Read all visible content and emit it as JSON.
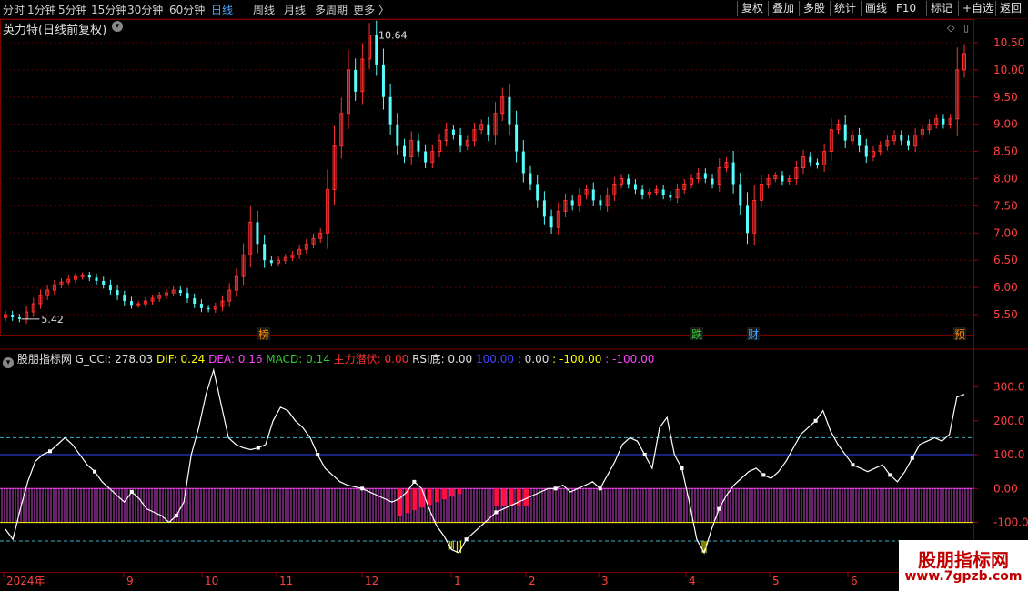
{
  "toolbar": {
    "periods": [
      "分时",
      "1分钟",
      "5分钟",
      "15分钟",
      "30分钟",
      "60分钟",
      "日线",
      "周线",
      "月线",
      "多周期",
      "更多"
    ],
    "active_period": "日线",
    "buttons": [
      "复权",
      "叠加",
      "多股",
      "统计",
      "画线",
      "F10",
      "标记",
      "+自选",
      "返回"
    ]
  },
  "main_chart": {
    "title": "英力特(日线前复权)",
    "price_axis": [
      "10.50",
      "10.00",
      "9.50",
      "9.00",
      "8.50",
      "8.00",
      "7.50",
      "7.00",
      "6.50",
      "6.00",
      "5.50"
    ],
    "high_label": "10.64",
    "low_label": "5.42",
    "markers": [
      {
        "text": "榜",
        "color": "#ff8c00"
      },
      {
        "text": "跌",
        "color": "#33cc33"
      },
      {
        "text": "财",
        "color": "#4da6ff"
      },
      {
        "text": "预",
        "color": "#ff8c00"
      }
    ]
  },
  "indicator": {
    "name": "股朋指标网",
    "items": [
      {
        "label": "G_CCI: 278.03",
        "color": "#e0e0e0"
      },
      {
        "label": "DIF: 0.24",
        "color": "#ffff00"
      },
      {
        "label": "DEA: 0.16",
        "color": "#ff44ff"
      },
      {
        "label": "MACD: 0.14",
        "color": "#33cc33"
      },
      {
        "label": "主力潜伏: 0.00",
        "color": "#ff3030"
      },
      {
        "label": "RSI底: 0.00",
        "color": "#e0e0e0"
      },
      {
        "label": "100.00",
        "color": "#4444ff"
      },
      {
        "label": ": 0.00",
        "color": "#e0e0e0"
      },
      {
        "label": ": -100.00",
        "color": "#ffff00"
      },
      {
        "label": ": -100.00",
        "color": "#ff44ff"
      }
    ],
    "axis": [
      "300.0",
      "200.0",
      "100.0",
      "0.00",
      "-100.0"
    ]
  },
  "date_axis": [
    "2024年",
    "9",
    "10",
    "11",
    "12",
    "1",
    "2",
    "3",
    "4",
    "5",
    "6"
  ],
  "watermark": {
    "line1": "股朋指标网",
    "line2": "www.7gpzb.com"
  },
  "colors": {
    "up": "#ff3030",
    "down": "#54ffff",
    "grid": "#5a0000",
    "axis_text": "#ff4040"
  },
  "chart_data": {
    "type": "candlestick",
    "price_range": [
      5.3,
      10.8
    ],
    "closes": [
      5.5,
      5.45,
      5.42,
      5.55,
      5.7,
      5.85,
      5.95,
      6.05,
      6.1,
      6.15,
      6.2,
      6.22,
      6.18,
      6.12,
      6.05,
      5.95,
      5.85,
      5.75,
      5.68,
      5.7,
      5.75,
      5.8,
      5.85,
      5.9,
      5.95,
      5.9,
      5.8,
      5.7,
      5.62,
      5.6,
      5.65,
      5.75,
      5.95,
      6.2,
      6.6,
      7.2,
      6.8,
      6.5,
      6.45,
      6.5,
      6.55,
      6.6,
      6.7,
      6.8,
      6.9,
      7.0,
      7.8,
      8.6,
      9.2,
      10.0,
      9.6,
      10.2,
      10.64,
      10.1,
      9.5,
      9.0,
      8.6,
      8.4,
      8.7,
      8.5,
      8.3,
      8.5,
      8.7,
      8.9,
      8.8,
      8.6,
      8.7,
      8.9,
      9.0,
      8.8,
      9.2,
      9.5,
      9.0,
      8.5,
      8.1,
      7.9,
      7.6,
      7.3,
      7.1,
      7.4,
      7.6,
      7.5,
      7.7,
      7.8,
      7.6,
      7.5,
      7.7,
      7.9,
      8.0,
      7.9,
      7.8,
      7.7,
      7.75,
      7.8,
      7.7,
      7.65,
      7.8,
      7.9,
      8.0,
      8.1,
      8.0,
      7.9,
      8.2,
      8.3,
      7.9,
      7.5,
      7.0,
      7.6,
      7.9,
      8.0,
      8.05,
      7.95,
      8.0,
      8.2,
      8.4,
      8.3,
      8.25,
      8.5,
      8.9,
      9.0,
      8.7,
      8.8,
      8.6,
      8.4,
      8.5,
      8.6,
      8.7,
      8.8,
      8.7,
      8.6,
      8.8,
      8.9,
      9.0,
      9.1,
      9.0,
      9.1,
      10.0,
      10.3
    ],
    "cci_range": [
      -230,
      390
    ],
    "cci": [
      -120,
      -150,
      -60,
      20,
      80,
      100,
      110,
      130,
      150,
      130,
      100,
      70,
      50,
      20,
      0,
      -20,
      -40,
      -10,
      -30,
      -60,
      -70,
      -80,
      -100,
      -80,
      -40,
      100,
      180,
      280,
      350,
      250,
      150,
      130,
      120,
      115,
      120,
      130,
      200,
      240,
      230,
      200,
      180,
      150,
      100,
      60,
      40,
      20,
      10,
      5,
      0,
      -10,
      -20,
      -30,
      -40,
      -30,
      -10,
      20,
      0,
      -60,
      -110,
      -140,
      -180,
      -190,
      -150,
      -130,
      -110,
      -90,
      -70,
      -60,
      -50,
      -40,
      -30,
      -20,
      -10,
      0,
      0,
      10,
      -10,
      0,
      10,
      20,
      0,
      40,
      80,
      130,
      150,
      140,
      100,
      60,
      180,
      210,
      100,
      60,
      -40,
      -150,
      -190,
      -120,
      -60,
      -20,
      10,
      30,
      50,
      60,
      40,
      30,
      50,
      80,
      120,
      160,
      180,
      200,
      230,
      170,
      130,
      100,
      70,
      60,
      50,
      60,
      70,
      40,
      20,
      50,
      90,
      130,
      140,
      150,
      140,
      160,
      270,
      278
    ]
  }
}
